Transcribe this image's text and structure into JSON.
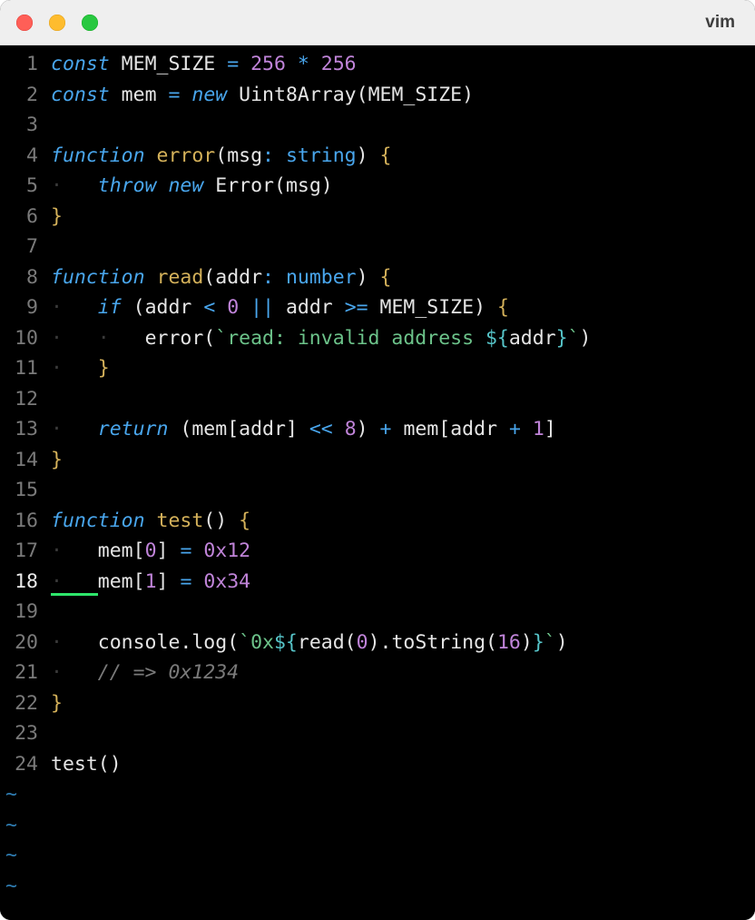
{
  "window": {
    "title": "vim"
  },
  "current_line": 18,
  "tilde_rows": 4,
  "lines": [
    {
      "n": 1,
      "indent": 0,
      "tokens": [
        {
          "t": "kw",
          "v": "const"
        },
        {
          "t": "ident",
          "v": " MEM_SIZE "
        },
        {
          "t": "op",
          "v": "="
        },
        {
          "t": "ident",
          "v": " "
        },
        {
          "t": "num",
          "v": "256"
        },
        {
          "t": "ident",
          "v": " "
        },
        {
          "t": "op",
          "v": "*"
        },
        {
          "t": "ident",
          "v": " "
        },
        {
          "t": "num",
          "v": "256"
        }
      ]
    },
    {
      "n": 2,
      "indent": 0,
      "tokens": [
        {
          "t": "kw",
          "v": "const"
        },
        {
          "t": "ident",
          "v": " mem "
        },
        {
          "t": "op",
          "v": "="
        },
        {
          "t": "ident",
          "v": " "
        },
        {
          "t": "kw",
          "v": "new"
        },
        {
          "t": "ident",
          "v": " "
        },
        {
          "t": "class",
          "v": "Uint8Array"
        },
        {
          "t": "punc",
          "v": "("
        },
        {
          "t": "ident",
          "v": "MEM_SIZE"
        },
        {
          "t": "punc",
          "v": ")"
        }
      ]
    },
    {
      "n": 3,
      "indent": 0,
      "tokens": []
    },
    {
      "n": 4,
      "indent": 0,
      "tokens": [
        {
          "t": "kw",
          "v": "function"
        },
        {
          "t": "ident",
          "v": " "
        },
        {
          "t": "func",
          "v": "error"
        },
        {
          "t": "punc",
          "v": "("
        },
        {
          "t": "ident",
          "v": "msg"
        },
        {
          "t": "op",
          "v": ":"
        },
        {
          "t": "ident",
          "v": " "
        },
        {
          "t": "type",
          "v": "string"
        },
        {
          "t": "punc",
          "v": ")"
        },
        {
          "t": "ident",
          "v": " "
        },
        {
          "t": "brace",
          "v": "{"
        }
      ]
    },
    {
      "n": 5,
      "indent": 1,
      "tokens": [
        {
          "t": "kw",
          "v": "throw"
        },
        {
          "t": "ident",
          "v": " "
        },
        {
          "t": "kw",
          "v": "new"
        },
        {
          "t": "ident",
          "v": " "
        },
        {
          "t": "class",
          "v": "Error"
        },
        {
          "t": "punc",
          "v": "("
        },
        {
          "t": "ident",
          "v": "msg"
        },
        {
          "t": "punc",
          "v": ")"
        }
      ]
    },
    {
      "n": 6,
      "indent": 0,
      "tokens": [
        {
          "t": "brace",
          "v": "}"
        }
      ]
    },
    {
      "n": 7,
      "indent": 0,
      "tokens": []
    },
    {
      "n": 8,
      "indent": 0,
      "tokens": [
        {
          "t": "kw",
          "v": "function"
        },
        {
          "t": "ident",
          "v": " "
        },
        {
          "t": "func",
          "v": "read"
        },
        {
          "t": "punc",
          "v": "("
        },
        {
          "t": "ident",
          "v": "addr"
        },
        {
          "t": "op",
          "v": ":"
        },
        {
          "t": "ident",
          "v": " "
        },
        {
          "t": "type",
          "v": "number"
        },
        {
          "t": "punc",
          "v": ")"
        },
        {
          "t": "ident",
          "v": " "
        },
        {
          "t": "brace",
          "v": "{"
        }
      ]
    },
    {
      "n": 9,
      "indent": 1,
      "tokens": [
        {
          "t": "kw",
          "v": "if"
        },
        {
          "t": "ident",
          "v": " "
        },
        {
          "t": "punc",
          "v": "("
        },
        {
          "t": "ident",
          "v": "addr "
        },
        {
          "t": "op",
          "v": "<"
        },
        {
          "t": "ident",
          "v": " "
        },
        {
          "t": "num",
          "v": "0"
        },
        {
          "t": "ident",
          "v": " "
        },
        {
          "t": "op",
          "v": "||"
        },
        {
          "t": "ident",
          "v": " addr "
        },
        {
          "t": "op",
          "v": ">="
        },
        {
          "t": "ident",
          "v": " MEM_SIZE"
        },
        {
          "t": "punc",
          "v": ")"
        },
        {
          "t": "ident",
          "v": " "
        },
        {
          "t": "brace",
          "v": "{"
        }
      ]
    },
    {
      "n": 10,
      "indent": 2,
      "tokens": [
        {
          "t": "call",
          "v": "error"
        },
        {
          "t": "punc",
          "v": "("
        },
        {
          "t": "str",
          "v": "`read: invalid address "
        },
        {
          "t": "interp",
          "v": "${"
        },
        {
          "t": "interpvar",
          "v": "addr"
        },
        {
          "t": "interp",
          "v": "}"
        },
        {
          "t": "str",
          "v": "`"
        },
        {
          "t": "punc",
          "v": ")"
        }
      ]
    },
    {
      "n": 11,
      "indent": 1,
      "tokens": [
        {
          "t": "brace",
          "v": "}"
        }
      ]
    },
    {
      "n": 12,
      "indent": 0,
      "tokens": []
    },
    {
      "n": 13,
      "indent": 1,
      "tokens": [
        {
          "t": "kw",
          "v": "return"
        },
        {
          "t": "ident",
          "v": " "
        },
        {
          "t": "punc",
          "v": "("
        },
        {
          "t": "ident",
          "v": "mem"
        },
        {
          "t": "punc",
          "v": "["
        },
        {
          "t": "ident",
          "v": "addr"
        },
        {
          "t": "punc",
          "v": "]"
        },
        {
          "t": "ident",
          "v": " "
        },
        {
          "t": "op",
          "v": "<<"
        },
        {
          "t": "ident",
          "v": " "
        },
        {
          "t": "num",
          "v": "8"
        },
        {
          "t": "punc",
          "v": ")"
        },
        {
          "t": "ident",
          "v": " "
        },
        {
          "t": "op",
          "v": "+"
        },
        {
          "t": "ident",
          "v": " mem"
        },
        {
          "t": "punc",
          "v": "["
        },
        {
          "t": "ident",
          "v": "addr "
        },
        {
          "t": "op",
          "v": "+"
        },
        {
          "t": "ident",
          "v": " "
        },
        {
          "t": "num",
          "v": "1"
        },
        {
          "t": "punc",
          "v": "]"
        }
      ]
    },
    {
      "n": 14,
      "indent": 0,
      "tokens": [
        {
          "t": "brace",
          "v": "}"
        }
      ]
    },
    {
      "n": 15,
      "indent": 0,
      "tokens": []
    },
    {
      "n": 16,
      "indent": 0,
      "tokens": [
        {
          "t": "kw",
          "v": "function"
        },
        {
          "t": "ident",
          "v": " "
        },
        {
          "t": "func",
          "v": "test"
        },
        {
          "t": "punc",
          "v": "()"
        },
        {
          "t": "ident",
          "v": " "
        },
        {
          "t": "brace",
          "v": "{"
        }
      ]
    },
    {
      "n": 17,
      "indent": 1,
      "tokens": [
        {
          "t": "ident",
          "v": "mem"
        },
        {
          "t": "punc",
          "v": "["
        },
        {
          "t": "num",
          "v": "0"
        },
        {
          "t": "punc",
          "v": "]"
        },
        {
          "t": "ident",
          "v": " "
        },
        {
          "t": "op",
          "v": "="
        },
        {
          "t": "ident",
          "v": " "
        },
        {
          "t": "num",
          "v": "0x12"
        }
      ]
    },
    {
      "n": 18,
      "indent": 1,
      "tokens": [
        {
          "t": "ident",
          "v": "mem"
        },
        {
          "t": "punc",
          "v": "["
        },
        {
          "t": "num",
          "v": "1"
        },
        {
          "t": "punc",
          "v": "]"
        },
        {
          "t": "ident",
          "v": " "
        },
        {
          "t": "op",
          "v": "="
        },
        {
          "t": "ident",
          "v": " "
        },
        {
          "t": "num",
          "v": "0x34"
        }
      ]
    },
    {
      "n": 19,
      "indent": 0,
      "tokens": []
    },
    {
      "n": 20,
      "indent": 1,
      "tokens": [
        {
          "t": "ident",
          "v": "console"
        },
        {
          "t": "punc",
          "v": "."
        },
        {
          "t": "call",
          "v": "log"
        },
        {
          "t": "punc",
          "v": "("
        },
        {
          "t": "str",
          "v": "`0x"
        },
        {
          "t": "interp",
          "v": "${"
        },
        {
          "t": "interpvar",
          "v": "read"
        },
        {
          "t": "punc",
          "v": "("
        },
        {
          "t": "num",
          "v": "0"
        },
        {
          "t": "punc",
          "v": ")"
        },
        {
          "t": "punc",
          "v": "."
        },
        {
          "t": "interpvar",
          "v": "toString"
        },
        {
          "t": "punc",
          "v": "("
        },
        {
          "t": "num",
          "v": "16"
        },
        {
          "t": "punc",
          "v": ")"
        },
        {
          "t": "interp",
          "v": "}"
        },
        {
          "t": "str",
          "v": "`"
        },
        {
          "t": "punc",
          "v": ")"
        }
      ]
    },
    {
      "n": 21,
      "indent": 1,
      "tokens": [
        {
          "t": "comment",
          "v": "// => 0x1234"
        }
      ]
    },
    {
      "n": 22,
      "indent": 0,
      "tokens": [
        {
          "t": "brace",
          "v": "}"
        }
      ]
    },
    {
      "n": 23,
      "indent": 0,
      "tokens": []
    },
    {
      "n": 24,
      "indent": 0,
      "tokens": [
        {
          "t": "call",
          "v": "test"
        },
        {
          "t": "punc",
          "v": "()"
        }
      ]
    }
  ]
}
